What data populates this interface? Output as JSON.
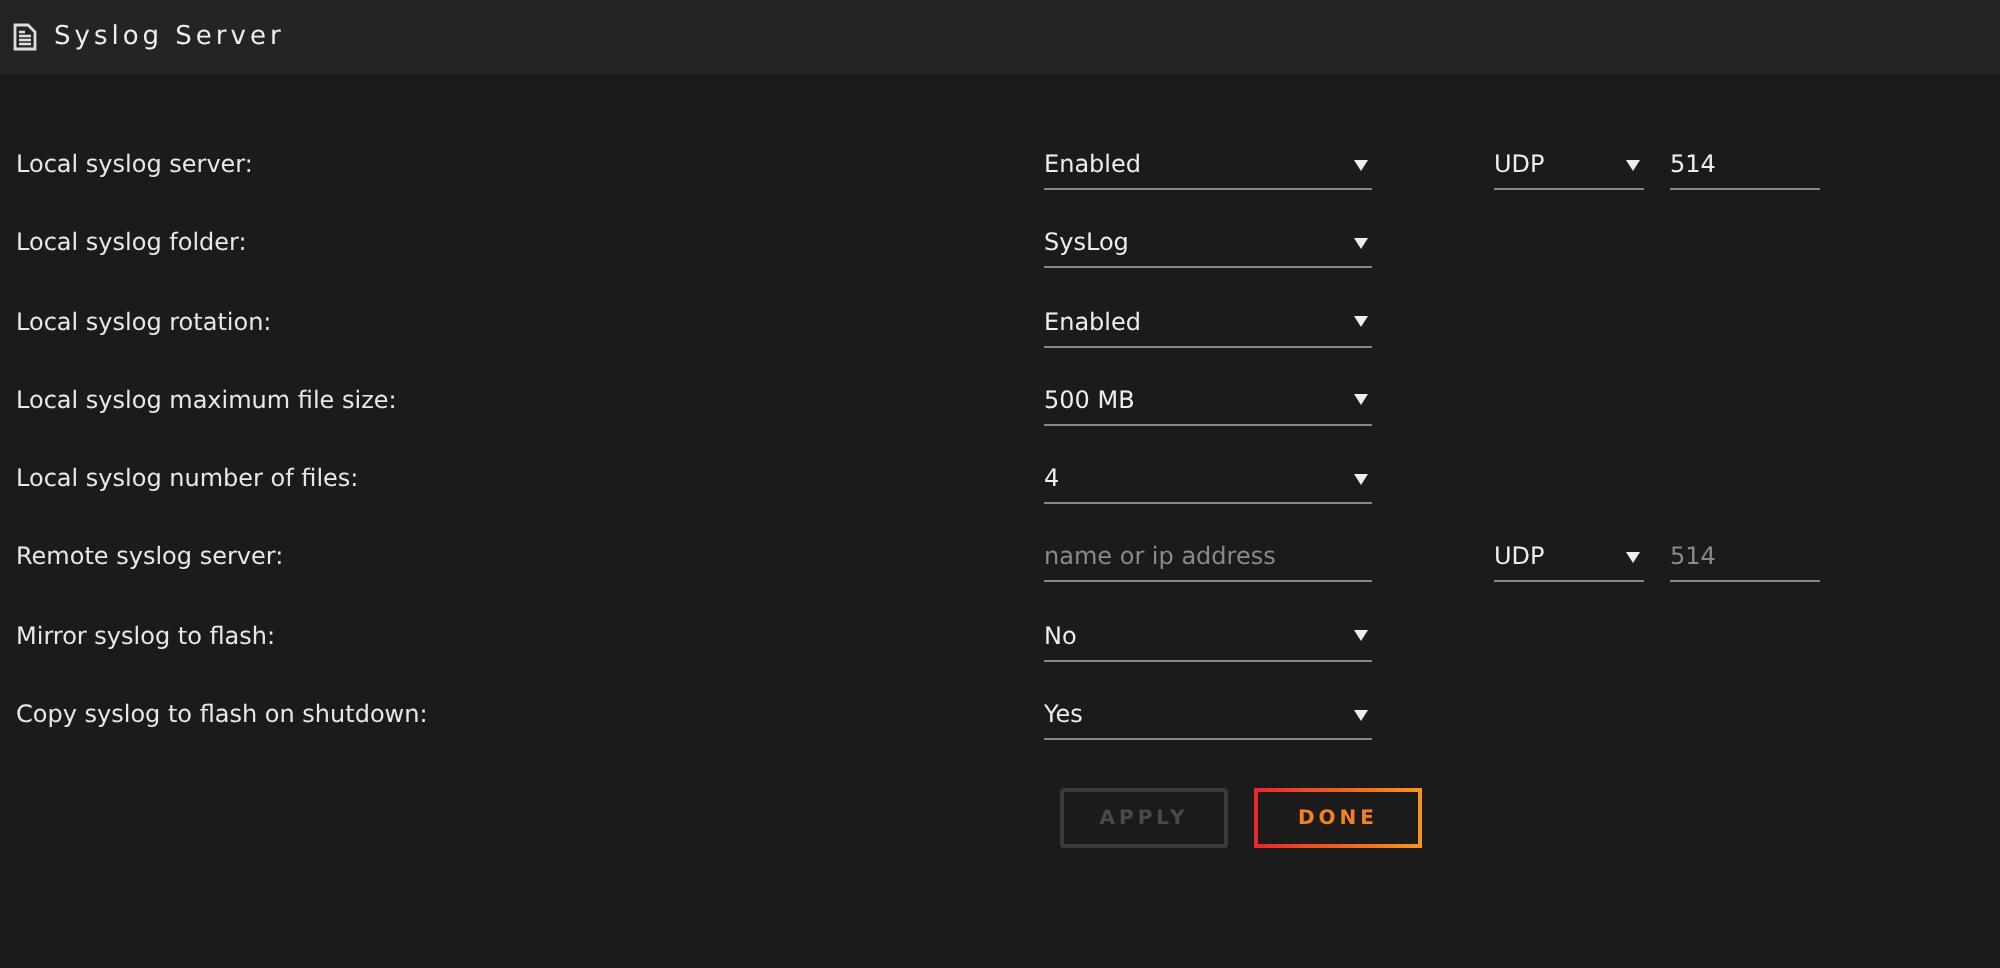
{
  "header": {
    "title": "Syslog Server"
  },
  "rows": [
    {
      "label": "Local syslog server:",
      "kind": "select",
      "value": "Enabled",
      "protocol": "UDP",
      "port": {
        "value": "514"
      }
    },
    {
      "label": "Local syslog folder:",
      "kind": "select",
      "value": "SysLog"
    },
    {
      "label": "Local syslog rotation:",
      "kind": "select",
      "value": "Enabled"
    },
    {
      "label": "Local syslog maximum file size:",
      "kind": "select",
      "value": "500 MB"
    },
    {
      "label": "Local syslog number of files:",
      "kind": "select",
      "value": "4"
    },
    {
      "label": "Remote syslog server:",
      "kind": "input",
      "placeholder": "name or ip address",
      "protocol": "UDP",
      "port": {
        "placeholder": "514"
      }
    },
    {
      "label": "Mirror syslog to flash:",
      "kind": "select",
      "value": "No"
    },
    {
      "label": "Copy syslog to flash on shutdown:",
      "kind": "select",
      "value": "Yes"
    }
  ],
  "buttons": [
    {
      "label": "APPLY",
      "kind": "secondary",
      "disabled": true
    },
    {
      "label": "DONE",
      "kind": "primary",
      "disabled": false
    }
  ]
}
